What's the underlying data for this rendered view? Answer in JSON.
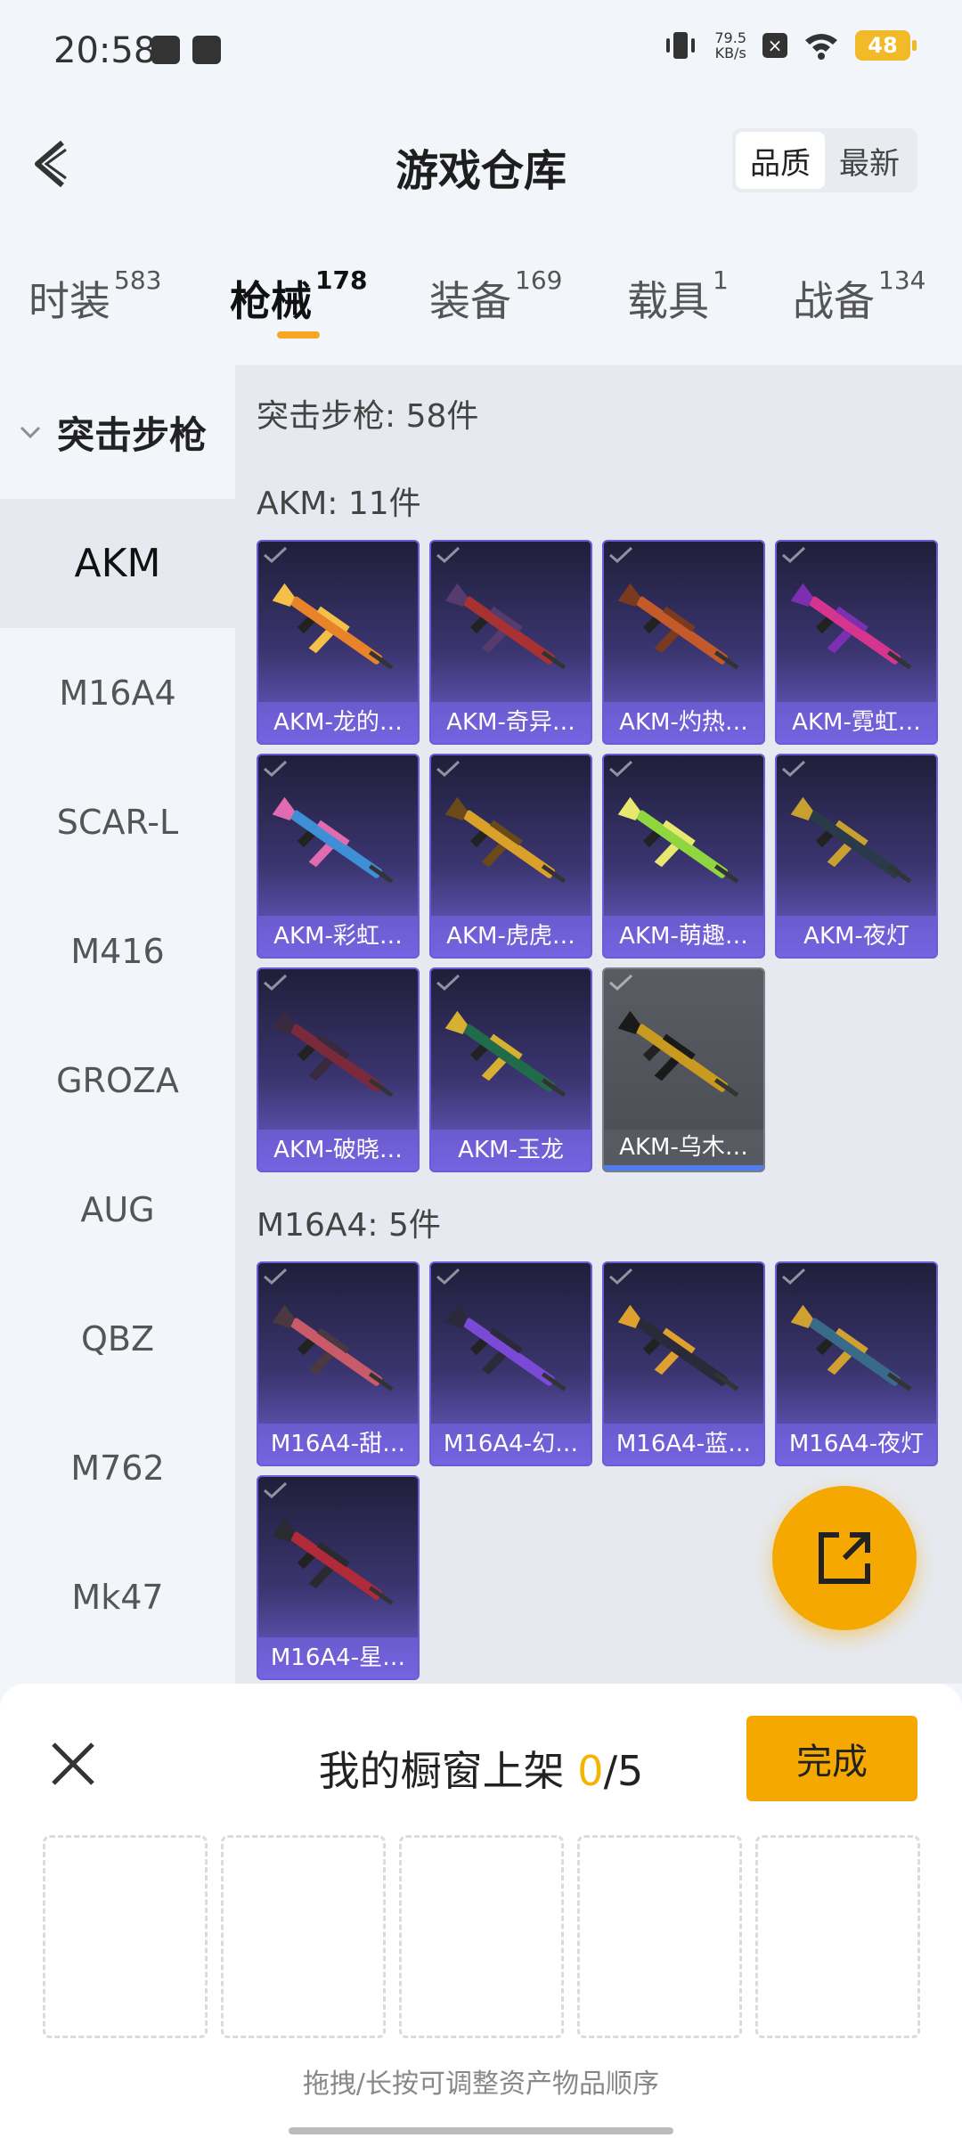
{
  "status": {
    "time": "20:58",
    "net_speed": "79.5",
    "net_unit": "KB/s",
    "battery": "48"
  },
  "header": {
    "title": "游戏仓库",
    "sort_quality": "品质",
    "sort_newest": "最新"
  },
  "tabs": [
    {
      "label": "时装",
      "count": "583"
    },
    {
      "label": "枪械",
      "count": "178"
    },
    {
      "label": "装备",
      "count": "169"
    },
    {
      "label": "载具",
      "count": "1"
    },
    {
      "label": "战备",
      "count": "134"
    }
  ],
  "sidebar": {
    "category": "突击步枪",
    "items": [
      "AKM",
      "M16A4",
      "SCAR-L",
      "M416",
      "GROZA",
      "AUG",
      "QBZ",
      "M762",
      "Mk47"
    ]
  },
  "main": {
    "category_count": "突击步枪: 58件",
    "groups": [
      {
        "title": "AKM: 11件",
        "items": [
          "AKM-龙的…",
          "AKM-奇异…",
          "AKM-灼热…",
          "AKM-霓虹…",
          "AKM-彩虹…",
          "AKM-虎虎…",
          "AKM-萌趣…",
          "AKM-夜灯",
          "AKM-破晓…",
          "AKM-玉龙",
          "AKM-乌木…"
        ]
      },
      {
        "title": "M16A4: 5件",
        "items": [
          "M16A4-甜…",
          "M16A4-幻…",
          "M16A4-蓝…",
          "M16A4-夜灯",
          "M16A4-星…"
        ]
      }
    ]
  },
  "sheet": {
    "title": "我的橱窗上架 ",
    "count": "0",
    "total": "/5",
    "done": "完成",
    "hint": "拖拽/长按可调整资产物品顺序"
  },
  "colors": {
    "accent": "#f5a800",
    "card_purple": "#6b5bd6"
  }
}
